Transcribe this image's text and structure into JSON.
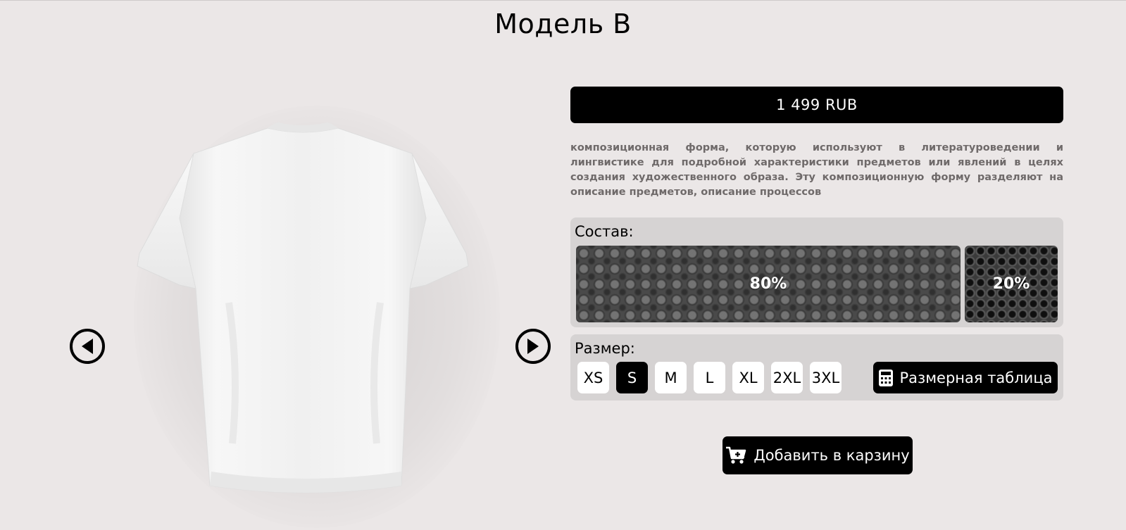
{
  "product": {
    "title": "Модель B",
    "price": "1 499 RUB",
    "description": "композиционная форма, которую используют в литературоведении и лингвистике для подробной характеристики предметов или явлений в целях создания художественного образа. Эту композиционную форму разделяют на описание предметов, описание процессов"
  },
  "gallery": {
    "prev_icon": "arrow-left-circle-icon",
    "next_icon": "arrow-right-circle-icon"
  },
  "composition": {
    "label": "Состав:",
    "parts": [
      {
        "label": "80%",
        "value": 80
      },
      {
        "label": "20%",
        "value": 20
      }
    ]
  },
  "sizes": {
    "label": "Размер:",
    "options": [
      "XS",
      "S",
      "M",
      "L",
      "XL",
      "2XL",
      "3XL"
    ],
    "selected": "S",
    "table_button": "Размерная таблица",
    "table_icon": "calculator-icon"
  },
  "cart": {
    "label": "Добавить в карзину",
    "icon": "cart-plus-icon"
  },
  "colors": {
    "background": "#ebe7e7",
    "panel": "#d6d3d3",
    "accent": "#000000"
  }
}
